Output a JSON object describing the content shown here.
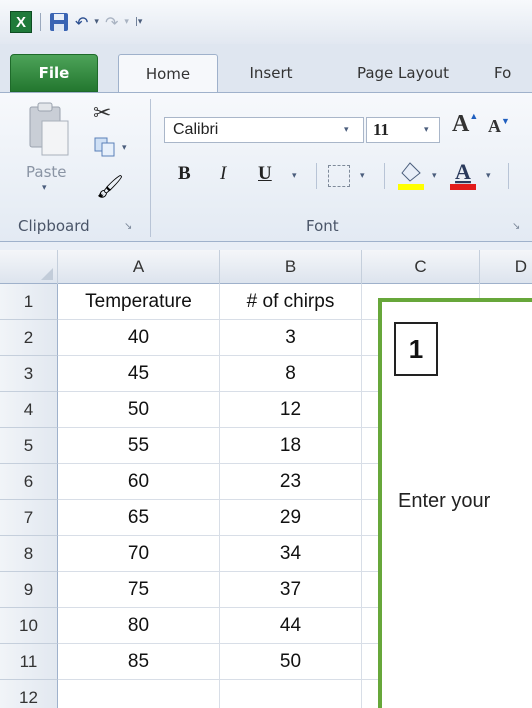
{
  "app": {
    "window_controls": {
      "undo_arrow": "▾",
      "redo_arrow": "▾",
      "customize": "|▾"
    }
  },
  "tabs": {
    "file": "File",
    "home": "Home",
    "insert": "Insert",
    "page_layout": "Page Layout",
    "formulas": "Fo"
  },
  "ribbon": {
    "clipboard": {
      "paste_label": "Paste",
      "group_label": "Clipboard",
      "launcher": "↘"
    },
    "font": {
      "font_name": "Calibri",
      "font_size": "11",
      "grow_label": "A",
      "shrink_label": "A",
      "bold": "B",
      "italic": "I",
      "underline": "U",
      "group_label": "Font",
      "launcher": "↘",
      "fill_color": "#ffff00",
      "font_color": "#e21b1b"
    }
  },
  "grid": {
    "columns": [
      "A",
      "B",
      "C",
      "D"
    ],
    "rows": [
      {
        "num": "1",
        "a": "Temperature",
        "b": "# of chirps"
      },
      {
        "num": "2",
        "a": "40",
        "b": "3"
      },
      {
        "num": "3",
        "a": "45",
        "b": "8"
      },
      {
        "num": "4",
        "a": "50",
        "b": "12"
      },
      {
        "num": "5",
        "a": "55",
        "b": "18"
      },
      {
        "num": "6",
        "a": "60",
        "b": "23"
      },
      {
        "num": "7",
        "a": "65",
        "b": "29"
      },
      {
        "num": "8",
        "a": "70",
        "b": "34"
      },
      {
        "num": "9",
        "a": "75",
        "b": "37"
      },
      {
        "num": "10",
        "a": "80",
        "b": "44"
      },
      {
        "num": "11",
        "a": "85",
        "b": "50"
      },
      {
        "num": "12",
        "a": "",
        "b": ""
      }
    ]
  },
  "overlay": {
    "step_number": "1",
    "instruction": "Enter your",
    "border_color": "#67a73a"
  }
}
